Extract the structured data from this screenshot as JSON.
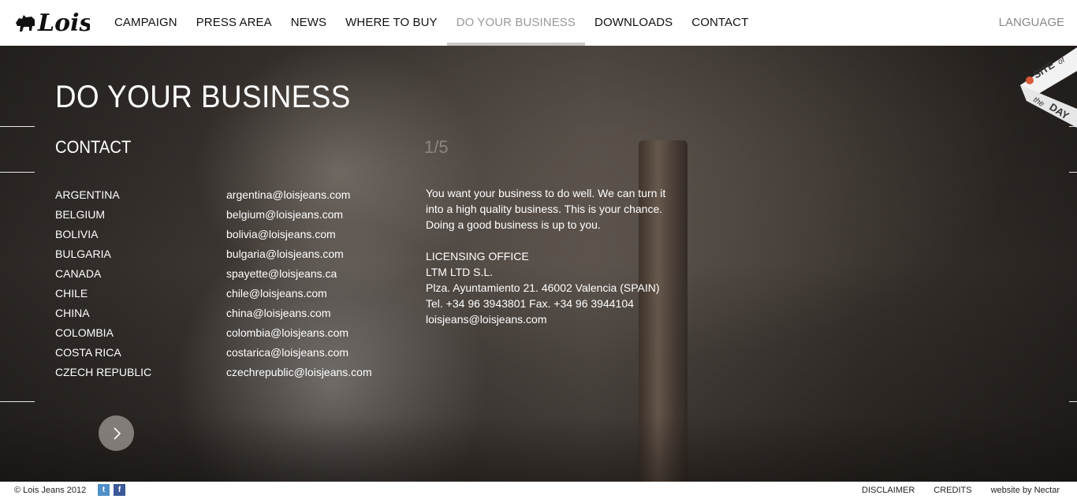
{
  "header": {
    "logo_text": "Lois",
    "nav": [
      {
        "label": "CAMPAIGN",
        "active": false
      },
      {
        "label": "PRESS AREA",
        "active": false
      },
      {
        "label": "NEWS",
        "active": false
      },
      {
        "label": "WHERE TO BUY",
        "active": false
      },
      {
        "label": "DO YOUR BUSINESS",
        "active": true
      },
      {
        "label": "DOWNLOADS",
        "active": false
      },
      {
        "label": "CONTACT",
        "active": false
      }
    ],
    "language_label": "LANGUAGE"
  },
  "main": {
    "title": "DO YOUR BUSINESS",
    "section_title": "CONTACT",
    "pager": "1/5",
    "contacts": [
      {
        "country": "ARGENTINA",
        "email": "argentina@loisjeans.com"
      },
      {
        "country": "BELGIUM",
        "email": "belgium@loisjeans.com"
      },
      {
        "country": "BOLIVIA",
        "email": "bolivia@loisjeans.com"
      },
      {
        "country": "BULGARIA",
        "email": "bulgaria@loisjeans.com"
      },
      {
        "country": "CANADA",
        "email": "spayette@loisjeans.ca"
      },
      {
        "country": "CHILE",
        "email": "chile@loisjeans.com"
      },
      {
        "country": "CHINA",
        "email": "china@loisjeans.com"
      },
      {
        "country": "COLOMBIA",
        "email": "colombia@loisjeans.com"
      },
      {
        "country": "COSTA RICA",
        "email": "costarica@loisjeans.com"
      },
      {
        "country": "CZECH REPUBLIC",
        "email": "czechrepublic@loisjeans.com"
      }
    ],
    "intro_lines": [
      "You want your business to do well. We can turn it",
      "into a high quality business. This is your chance.",
      "Doing a good business is up to you."
    ],
    "office_lines": [
      "LICENSING OFFICE",
      "LTM LTD S.L.",
      "Plza. Ayuntamiento 21. 46002 Valencia (SPAIN)",
      "Tel. +34 96 3943801 Fax. +34 96 3944104",
      "loisjeans@loisjeans.com"
    ],
    "next_icon": "chevron-right-icon"
  },
  "badge": {
    "line1": "SITE",
    "line1b": "of",
    "line2a": "the",
    "line2b": "DAY"
  },
  "footer": {
    "copyright": "© Lois Jeans 2012",
    "social": [
      {
        "icon": "twitter-icon",
        "glyph": "t"
      },
      {
        "icon": "facebook-icon",
        "glyph": "f"
      }
    ],
    "links": [
      "DISCLAIMER",
      "CREDITS",
      "website by Nectar"
    ]
  },
  "colors": {
    "nav_active": "#999999",
    "nav_underline": "#c8c8c8",
    "pager": "#8a8581",
    "twitter": "#4f8fc8",
    "facebook": "#3b5998"
  }
}
